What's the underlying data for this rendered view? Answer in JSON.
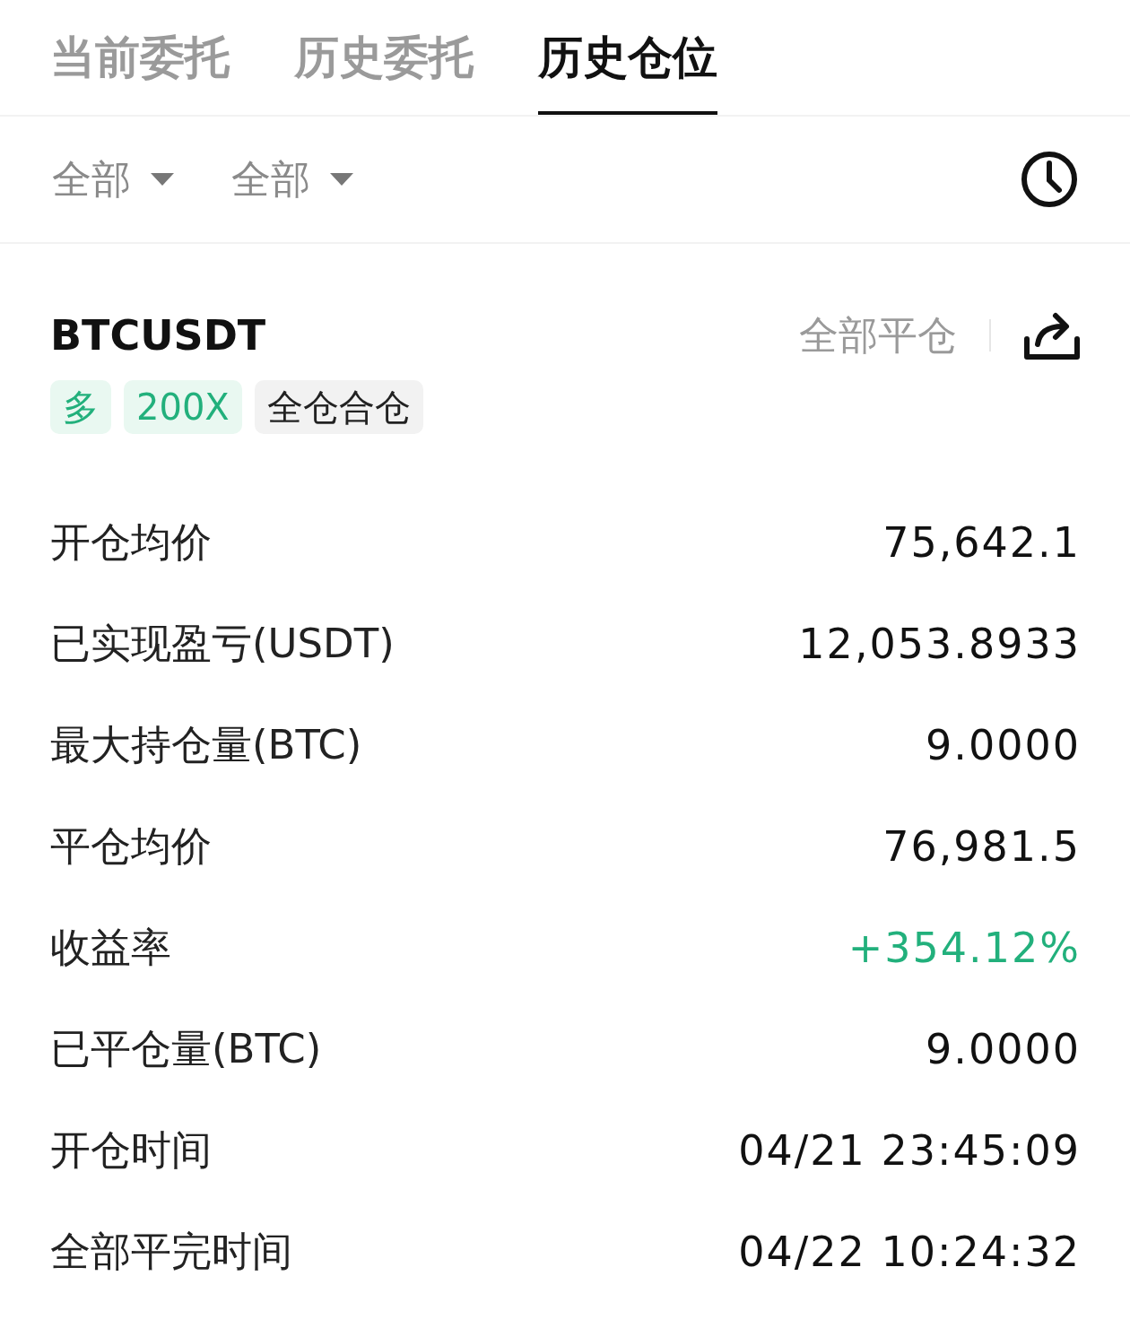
{
  "tabs": [
    {
      "label": "当前委托",
      "selected": false
    },
    {
      "label": "历史委托",
      "selected": false
    },
    {
      "label": "历史仓位",
      "selected": true
    }
  ],
  "filters": [
    {
      "label": "全部"
    },
    {
      "label": "全部"
    }
  ],
  "position": {
    "symbol": "BTCUSDT",
    "close_all_label": "全部平仓",
    "tags": [
      {
        "label": "多",
        "kind": "direction"
      },
      {
        "label": "200X",
        "kind": "leverage"
      },
      {
        "label": "全仓合仓",
        "kind": "margin"
      }
    ],
    "fields": [
      {
        "label": "开仓均价",
        "value": "75,642.1",
        "kind": "plain"
      },
      {
        "label": "已实现盈亏(USDT)",
        "value": "12,053.8933",
        "kind": "plain"
      },
      {
        "label": "最大持仓量(BTC)",
        "value": "9.0000",
        "kind": "plain"
      },
      {
        "label": "平仓均价",
        "value": "76,981.5",
        "kind": "plain"
      },
      {
        "label": "收益率",
        "value": "+354.12%",
        "kind": "profit"
      },
      {
        "label": "已平仓量(BTC)",
        "value": "9.0000",
        "kind": "plain"
      },
      {
        "label": "开仓时间",
        "value": "04/21 23:45:09",
        "kind": "plain"
      },
      {
        "label": "全部平完时间",
        "value": "04/22 10:24:32",
        "kind": "plain"
      }
    ]
  }
}
